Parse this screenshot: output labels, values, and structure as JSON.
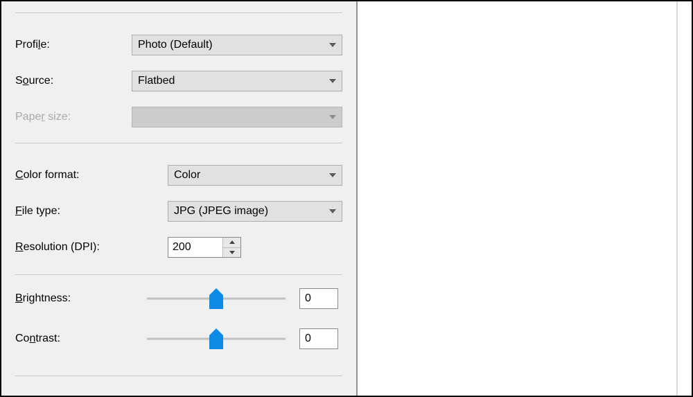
{
  "labels": {
    "profile": "Profile:",
    "source": "Source:",
    "paper_size": "Paper size:",
    "color_format": "Color format:",
    "file_type": "File type:",
    "resolution": "Resolution (DPI):",
    "brightness": "Brightness:",
    "contrast": "Contrast:"
  },
  "values": {
    "profile": "Photo (Default)",
    "source": "Flatbed",
    "paper_size": "",
    "color_format": "Color",
    "file_type": "JPG (JPEG image)",
    "resolution": "200",
    "brightness": "0",
    "contrast": "0"
  },
  "accent_color": "#0d8ae6"
}
